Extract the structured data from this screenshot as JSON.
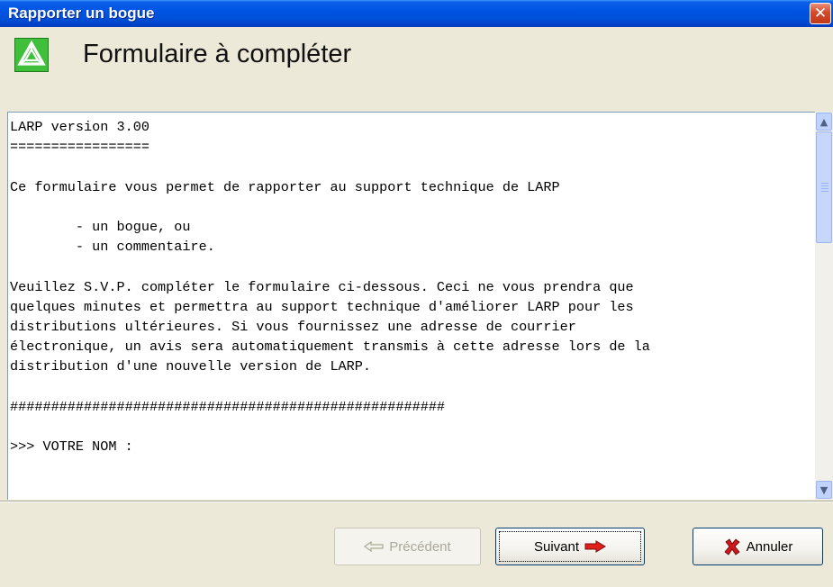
{
  "window": {
    "title": "Rapporter un bogue",
    "close_icon": "close-icon"
  },
  "header": {
    "title": "Formulaire à compléter",
    "logo_icon": "larp-logo-icon"
  },
  "form_text": "LARP version 3.00\n=================\n\nCe formulaire vous permet de rapporter au support technique de LARP\n\n        - un bogue, ou\n        - un commentaire.\n\nVeuillez S.V.P. compléter le formulaire ci-dessous. Ceci ne vous prendra que\nquelques minutes et permettra au support technique d'améliorer LARP pour les\ndistributions ultérieures. Si vous fournissez une adresse de courrier\nélectronique, un avis sera automatiquement transmis à cette adresse lors de la\ndistribution d'une nouvelle version de LARP.\n\n#####################################################\n\n>>> VOTRE NOM :",
  "buttons": {
    "previous": {
      "label": "Précédent",
      "icon": "arrow-left-icon"
    },
    "next": {
      "label": "Suivant",
      "icon": "arrow-right-icon"
    },
    "cancel": {
      "label": "Annuler",
      "icon": "cancel-x-icon"
    }
  },
  "colors": {
    "titlebar": "#0054e3",
    "close_button": "#d24a2a",
    "logo": "#3fbf3a",
    "next_arrow": "#e0201a",
    "cancel_x": "#d01818"
  }
}
